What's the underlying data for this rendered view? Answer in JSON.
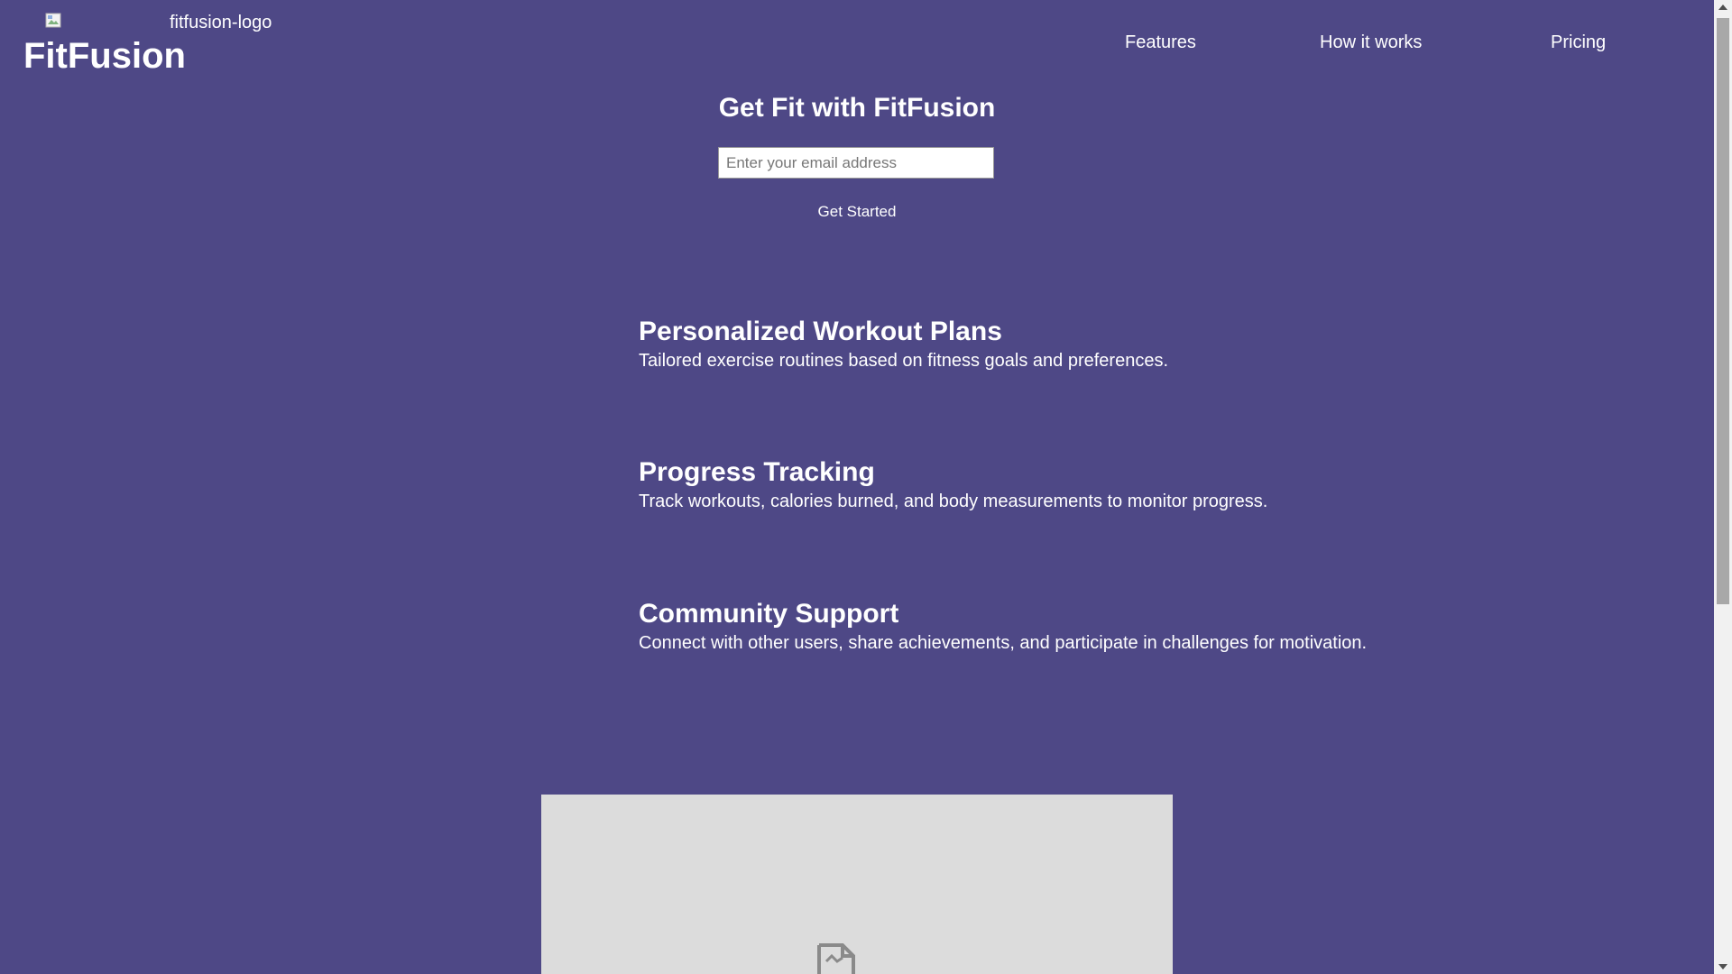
{
  "header": {
    "logo_alt": "fitfusion-logo",
    "brand_name": "FitFusion",
    "nav": [
      {
        "label": "Features"
      },
      {
        "label": "How it works"
      },
      {
        "label": "Pricing"
      }
    ]
  },
  "hero": {
    "title": "Get Fit with FitFusion",
    "email_placeholder": "Enter your email address",
    "email_value": "",
    "cta_label": "Get Started"
  },
  "features": [
    {
      "title": "Personalized Workout Plans",
      "description": "Tailored exercise routines based on fitness goals and preferences."
    },
    {
      "title": "Progress Tracking",
      "description": "Track workouts, calories burned, and body measurements to monitor progress."
    },
    {
      "title": "Community Support",
      "description": "Connect with other users, share achievements, and participate in challenges for motivation."
    }
  ],
  "colors": {
    "background": "#4e4886",
    "text": "#ffffff",
    "placeholder_box": "#dcdcdc"
  },
  "icons": {
    "logo": "broken-image-icon",
    "media": "image-placeholder-icon"
  }
}
